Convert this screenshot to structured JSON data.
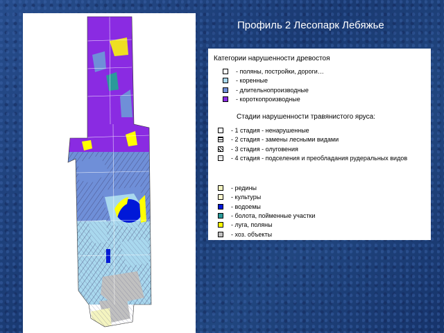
{
  "title": "Профиль 2 Лесопарк Лебяжье",
  "legend": {
    "forest_heading": "Категории нарушенности древостоя",
    "forest_items": [
      {
        "label": "- поляны, постройки, дороги…",
        "color": "#ffffff"
      },
      {
        "label": "- коренные",
        "color": "#a9d8ee"
      },
      {
        "label": "- длительнопроизводные",
        "color": "#6f8fd8"
      },
      {
        "label": "- короткопроизводные",
        "color": "#8a2be2"
      }
    ],
    "grass_heading": "Стадии нарушенности травянистого яруса:",
    "grass_items": [
      {
        "label": "- 1 стадия - ненарушенные",
        "pattern": "none"
      },
      {
        "label": "- 2 стадия - замены лесными видами",
        "pattern": "horizontal"
      },
      {
        "label": "- 3 стадия - олуговения",
        "pattern": "diagonal"
      },
      {
        "label": "- 4 стадия - подселения и преобладания рудеральных видов",
        "pattern": "light"
      }
    ],
    "other_items": [
      {
        "label": "- редины",
        "color": "#f4f4c0"
      },
      {
        "label": "- культуры",
        "color": "#fffbd0"
      },
      {
        "label": "- водоемы",
        "color": "#0018d8"
      },
      {
        "label": "- болота, пойменные участки",
        "color": "#2a9a9a"
      },
      {
        "label": "- луга, поляны",
        "color": "#ffff00"
      },
      {
        "label": "- хоз. объекты",
        "color": "#c0c0c0"
      }
    ]
  },
  "map": {
    "colors": {
      "short": "#8a2be2",
      "long": "#6f8fd8",
      "native": "#a9d8ee",
      "water": "#0018d8",
      "swamp": "#2a9a9a",
      "meadow": "#ffff00",
      "utility": "#c0c0c0",
      "sparse": "#f4f4c0"
    }
  }
}
